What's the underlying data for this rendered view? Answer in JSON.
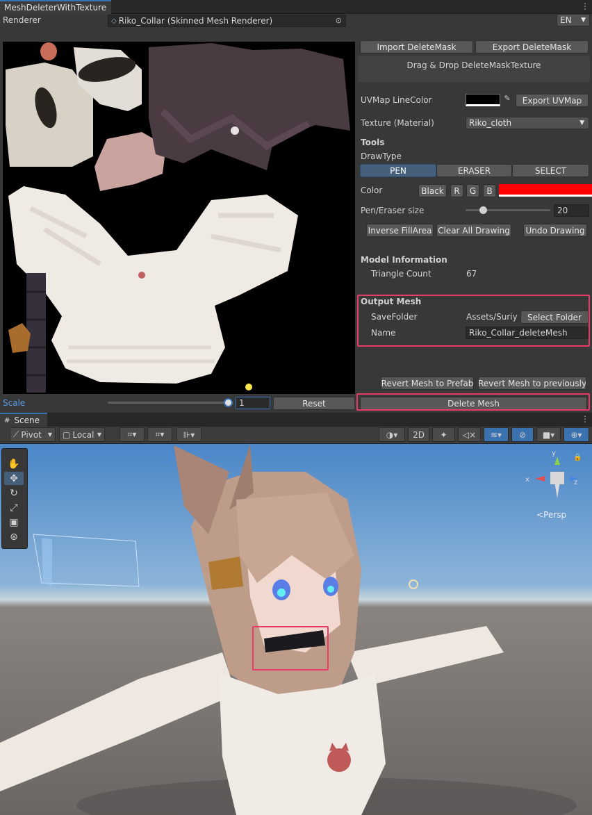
{
  "window": {
    "tab_title": "MeshDeleterWithTexture",
    "renderer_label": "Renderer",
    "renderer_value": "Riko_Collar (Skinned Mesh Renderer)",
    "language": "EN"
  },
  "buttons": {
    "import_mask": "Import DeleteMask",
    "export_mask": "Export DeleteMask",
    "drop_hint": "Drag & Drop DeleteMaskTexture",
    "export_uvmap": "Export UVMap",
    "inverse_fill": "Inverse FillArea",
    "clear_all": "Clear All Drawing",
    "undo_drawing": "Undo Drawing",
    "select_folder": "Select Folder",
    "revert_prefab": "Revert Mesh to Prefab",
    "revert_previous": "Revert Mesh to previously",
    "delete_mesh": "Delete Mesh",
    "reset": "Reset"
  },
  "uvmap": {
    "label": "UVMap LineColor"
  },
  "texture": {
    "label": "Texture (Material)",
    "value": "Riko_cloth"
  },
  "tools": {
    "heading": "Tools",
    "drawtype_label": "DrawType",
    "modes": [
      "PEN",
      "ERASER",
      "SELECT"
    ],
    "active_mode": "PEN",
    "color_label": "Color",
    "color_buttons": [
      "Black",
      "R",
      "G",
      "B"
    ],
    "pen_color": "#ff0000",
    "pen_size_label": "Pen/Eraser size",
    "pen_size": "20"
  },
  "model_info": {
    "heading": "Model Information",
    "triangle_label": "Triangle Count",
    "triangle_count": "67"
  },
  "output_mesh": {
    "heading": "Output Mesh",
    "savefolder_label": "SaveFolder",
    "savefolder_value": "Assets/Suriyu",
    "name_label": "Name",
    "name_value": "Riko_Collar_deleteMesh"
  },
  "scale": {
    "label": "Scale",
    "value": "1"
  },
  "scene": {
    "tab_title": "Scene",
    "pivot": "Pivot",
    "local": "Local",
    "mode_2d": "2D",
    "persp": "Persp",
    "gizmo_axes": [
      "y",
      "x",
      "z"
    ]
  },
  "colors": {
    "accent": "#3a72b0",
    "highlight": "#ea3a6a",
    "panel": "#383838"
  }
}
